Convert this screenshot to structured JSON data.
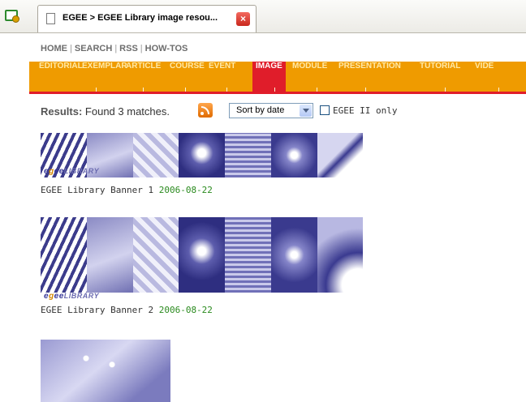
{
  "browser": {
    "tab_title": "EGEE > EGEE Library image resou...",
    "tab_close_glyph": "×"
  },
  "topnav": {
    "items": [
      "HOME",
      "SEARCH",
      "RSS",
      "HOW-TOS"
    ]
  },
  "categories": {
    "items": [
      "EDITORIAL",
      "EXEMPLAR",
      "ARTICLE",
      "COURSE",
      "EVENT",
      "IMAGE",
      "MODULE",
      "PRESENTATION",
      "TUTORIAL",
      "VIDE"
    ],
    "active": "IMAGE",
    "bar_color": "#ef9b00",
    "active_color": "#e01d2a"
  },
  "results": {
    "label": "Results:",
    "text": "Found 3 matches.",
    "sort_value": "Sort by date",
    "checkbox_label": "EGEE II only",
    "checkbox_checked": false
  },
  "items": [
    {
      "logo_e": "e",
      "logo_g": "g",
      "logo_ee": "ee",
      "logo_lib": "LIBRARY",
      "title": "EGEE Library Banner 1",
      "date": "2006-08-22"
    },
    {
      "logo_e": "e",
      "logo_g": "g",
      "logo_ee": "ee",
      "logo_lib": "LIBRARY",
      "title": "EGEE Library Banner 2",
      "date": "2006-08-22"
    }
  ],
  "icons": {
    "new_tab": "new-tab-icon",
    "page": "document-icon",
    "close": "close-icon",
    "rss": "rss-icon",
    "dropdown": "chevron-down-icon"
  }
}
